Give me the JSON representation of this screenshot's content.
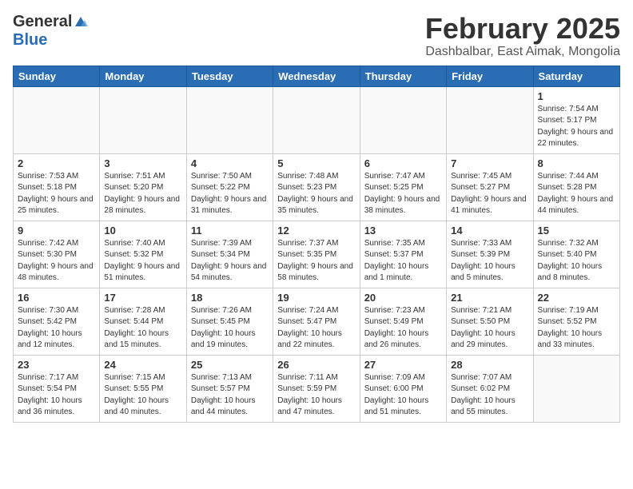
{
  "header": {
    "logo_general": "General",
    "logo_blue": "Blue",
    "month_title": "February 2025",
    "location": "Dashbalbar, East Aimak, Mongolia"
  },
  "weekdays": [
    "Sunday",
    "Monday",
    "Tuesday",
    "Wednesday",
    "Thursday",
    "Friday",
    "Saturday"
  ],
  "weeks": [
    [
      {
        "day": "",
        "info": ""
      },
      {
        "day": "",
        "info": ""
      },
      {
        "day": "",
        "info": ""
      },
      {
        "day": "",
        "info": ""
      },
      {
        "day": "",
        "info": ""
      },
      {
        "day": "",
        "info": ""
      },
      {
        "day": "1",
        "info": "Sunrise: 7:54 AM\nSunset: 5:17 PM\nDaylight: 9 hours and 22 minutes."
      }
    ],
    [
      {
        "day": "2",
        "info": "Sunrise: 7:53 AM\nSunset: 5:18 PM\nDaylight: 9 hours and 25 minutes."
      },
      {
        "day": "3",
        "info": "Sunrise: 7:51 AM\nSunset: 5:20 PM\nDaylight: 9 hours and 28 minutes."
      },
      {
        "day": "4",
        "info": "Sunrise: 7:50 AM\nSunset: 5:22 PM\nDaylight: 9 hours and 31 minutes."
      },
      {
        "day": "5",
        "info": "Sunrise: 7:48 AM\nSunset: 5:23 PM\nDaylight: 9 hours and 35 minutes."
      },
      {
        "day": "6",
        "info": "Sunrise: 7:47 AM\nSunset: 5:25 PM\nDaylight: 9 hours and 38 minutes."
      },
      {
        "day": "7",
        "info": "Sunrise: 7:45 AM\nSunset: 5:27 PM\nDaylight: 9 hours and 41 minutes."
      },
      {
        "day": "8",
        "info": "Sunrise: 7:44 AM\nSunset: 5:28 PM\nDaylight: 9 hours and 44 minutes."
      }
    ],
    [
      {
        "day": "9",
        "info": "Sunrise: 7:42 AM\nSunset: 5:30 PM\nDaylight: 9 hours and 48 minutes."
      },
      {
        "day": "10",
        "info": "Sunrise: 7:40 AM\nSunset: 5:32 PM\nDaylight: 9 hours and 51 minutes."
      },
      {
        "day": "11",
        "info": "Sunrise: 7:39 AM\nSunset: 5:34 PM\nDaylight: 9 hours and 54 minutes."
      },
      {
        "day": "12",
        "info": "Sunrise: 7:37 AM\nSunset: 5:35 PM\nDaylight: 9 hours and 58 minutes."
      },
      {
        "day": "13",
        "info": "Sunrise: 7:35 AM\nSunset: 5:37 PM\nDaylight: 10 hours and 1 minute."
      },
      {
        "day": "14",
        "info": "Sunrise: 7:33 AM\nSunset: 5:39 PM\nDaylight: 10 hours and 5 minutes."
      },
      {
        "day": "15",
        "info": "Sunrise: 7:32 AM\nSunset: 5:40 PM\nDaylight: 10 hours and 8 minutes."
      }
    ],
    [
      {
        "day": "16",
        "info": "Sunrise: 7:30 AM\nSunset: 5:42 PM\nDaylight: 10 hours and 12 minutes."
      },
      {
        "day": "17",
        "info": "Sunrise: 7:28 AM\nSunset: 5:44 PM\nDaylight: 10 hours and 15 minutes."
      },
      {
        "day": "18",
        "info": "Sunrise: 7:26 AM\nSunset: 5:45 PM\nDaylight: 10 hours and 19 minutes."
      },
      {
        "day": "19",
        "info": "Sunrise: 7:24 AM\nSunset: 5:47 PM\nDaylight: 10 hours and 22 minutes."
      },
      {
        "day": "20",
        "info": "Sunrise: 7:23 AM\nSunset: 5:49 PM\nDaylight: 10 hours and 26 minutes."
      },
      {
        "day": "21",
        "info": "Sunrise: 7:21 AM\nSunset: 5:50 PM\nDaylight: 10 hours and 29 minutes."
      },
      {
        "day": "22",
        "info": "Sunrise: 7:19 AM\nSunset: 5:52 PM\nDaylight: 10 hours and 33 minutes."
      }
    ],
    [
      {
        "day": "23",
        "info": "Sunrise: 7:17 AM\nSunset: 5:54 PM\nDaylight: 10 hours and 36 minutes."
      },
      {
        "day": "24",
        "info": "Sunrise: 7:15 AM\nSunset: 5:55 PM\nDaylight: 10 hours and 40 minutes."
      },
      {
        "day": "25",
        "info": "Sunrise: 7:13 AM\nSunset: 5:57 PM\nDaylight: 10 hours and 44 minutes."
      },
      {
        "day": "26",
        "info": "Sunrise: 7:11 AM\nSunset: 5:59 PM\nDaylight: 10 hours and 47 minutes."
      },
      {
        "day": "27",
        "info": "Sunrise: 7:09 AM\nSunset: 6:00 PM\nDaylight: 10 hours and 51 minutes."
      },
      {
        "day": "28",
        "info": "Sunrise: 7:07 AM\nSunset: 6:02 PM\nDaylight: 10 hours and 55 minutes."
      },
      {
        "day": "",
        "info": ""
      }
    ]
  ]
}
